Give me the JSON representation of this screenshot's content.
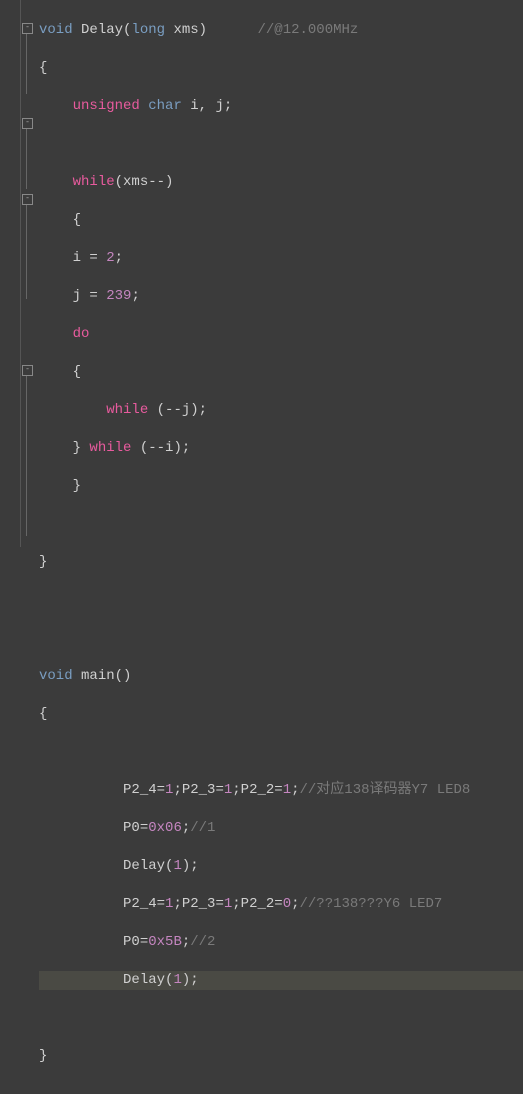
{
  "func1": {
    "ret": "void",
    "name": "Delay",
    "param_type": "long",
    "param_name": "xms",
    "comment": "//@12.000MHz"
  },
  "decl": {
    "mod": "unsigned",
    "type": "char",
    "vars": "i, j;"
  },
  "while1": {
    "kw": "while",
    "expr": "(xms--)"
  },
  "assign_i": {
    "var": "i",
    "op": "=",
    "val": "2",
    "semi": ";"
  },
  "assign_j": {
    "var": "j",
    "op": "=",
    "val": "239",
    "semi": ";"
  },
  "do_kw": "do",
  "inner_while": {
    "kw": "while",
    "expr": "(--j);"
  },
  "close_while_i": {
    "brace": "}",
    "kw": "while",
    "expr": "(--i);"
  },
  "func2": {
    "ret": "void",
    "name": "main",
    "params": "()"
  },
  "body": {
    "l1a": "P2_4=",
    "l1b": "1",
    "l1c": ";P2_3=",
    "l1d": "1",
    "l1e": ";P2_2=",
    "l1f": "1",
    "l1g": ";",
    "l1cmt": "//对应138译码器Y7 LED8",
    "l2a": "P0=",
    "l2b": "0x06",
    "l2c": ";",
    "l2cmt": "//1",
    "l3a": "Delay(",
    "l3b": "1",
    "l3c": ");",
    "l4a": "P2_4=",
    "l4b": "1",
    "l4c": ";P2_3=",
    "l4d": "1",
    "l4e": ";P2_2=",
    "l4f": "0",
    "l4g": ";",
    "l4cmt": "//??138???Y6 LED7",
    "l5a": "P0=",
    "l5b": "0x5B",
    "l5c": ";",
    "l5cmt": "//2",
    "l6a": "Delay(",
    "l6b": "1",
    "l6c": ");"
  },
  "braces": {
    "open": "{",
    "close": "}"
  }
}
